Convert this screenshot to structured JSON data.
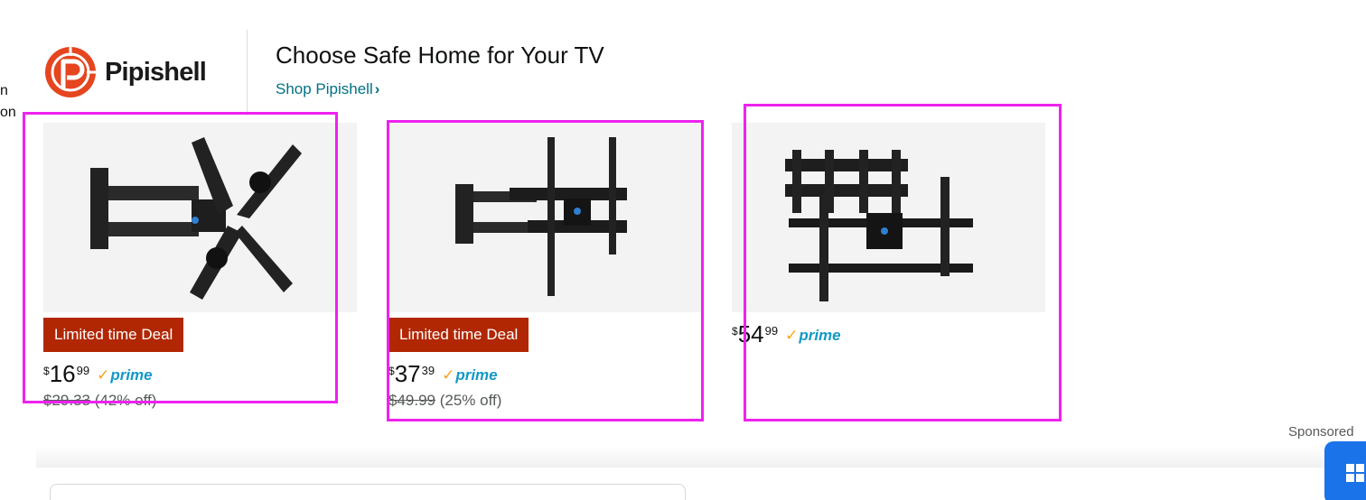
{
  "edge_text": [
    "n",
    "on"
  ],
  "brand": {
    "name": "Pipishell",
    "headline": "Choose Safe Home for Your TV",
    "shop_link": "Shop Pipishell",
    "shop_link_chevron": "›",
    "colors": {
      "logo": "#e5451f",
      "link": "#007185"
    }
  },
  "products": [
    {
      "image_icon": "tv-wall-mount-icon",
      "deal_badge": "Limited time Deal",
      "price_symbol": "$",
      "price_whole": "16",
      "price_fraction": "99",
      "prime": "prime",
      "prime_check": "✓",
      "was_price": "$29.33",
      "discount": "(42% off)"
    },
    {
      "image_icon": "tv-wall-mount-icon",
      "deal_badge": "Limited time Deal",
      "price_symbol": "$",
      "price_whole": "37",
      "price_fraction": "39",
      "prime": "prime",
      "prime_check": "✓",
      "was_price": "$49.99",
      "discount": "(25% off)"
    },
    {
      "image_icon": "tv-wall-mount-icon",
      "price_symbol": "$",
      "price_whole": "54",
      "price_fraction": "99",
      "prime": "prime",
      "prime_check": "✓"
    }
  ],
  "sponsored": "Sponsored",
  "colors": {
    "deal_badge": "#b12704",
    "prime": "#1399c6",
    "selection": "#ee22ee",
    "fab": "#1a73e8"
  }
}
